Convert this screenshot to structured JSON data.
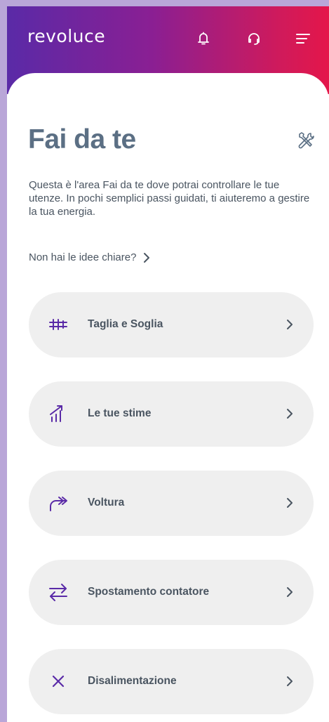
{
  "header": {
    "logo": "revoluce",
    "icons": [
      "bell-icon",
      "headset-icon",
      "menu-icon"
    ]
  },
  "page": {
    "title": "Fai da te",
    "intro": "Questa è l'area Fai da te dove potrai controllare le tue utenze. In pochi semplici passi guidati, ti aiuteremo a gestire la tua energia.",
    "help_link": "Non hai le idee chiare?"
  },
  "menu": {
    "items": [
      {
        "label": "Taglia e Soglia",
        "icon": "sliders-icon"
      },
      {
        "label": "Le tue stime",
        "icon": "chart-growth-icon"
      },
      {
        "label": "Voltura",
        "icon": "transfer-arrow-icon"
      },
      {
        "label": "Spostamento contatore",
        "icon": "swap-arrows-icon"
      },
      {
        "label": "Disalimentazione",
        "icon": "close-icon"
      }
    ]
  },
  "colors": {
    "gradient_start": "#5a2aa7",
    "gradient_end": "#e4164a",
    "accent_icon": "#5a2aa7",
    "title": "#5b6f84",
    "text": "#4a5561",
    "item_bg": "#efefef"
  }
}
